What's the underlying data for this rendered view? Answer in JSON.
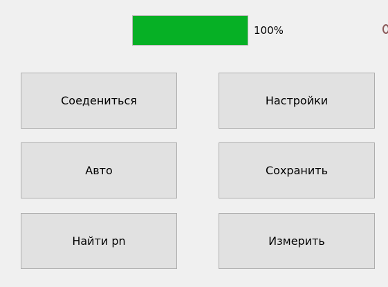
{
  "progress": {
    "value": 1.0,
    "label": "100%"
  },
  "buttons": {
    "connect": "Соедениться",
    "settings": "Настройки",
    "auto": "Авто",
    "save": "Сохранить",
    "find": "Найти pn",
    "measure": "Измерить"
  },
  "colors": {
    "background": "#f0f0f0",
    "progress_fill": "#06b025",
    "button_face": "#e1e1e1",
    "button_border": "#adadad"
  }
}
